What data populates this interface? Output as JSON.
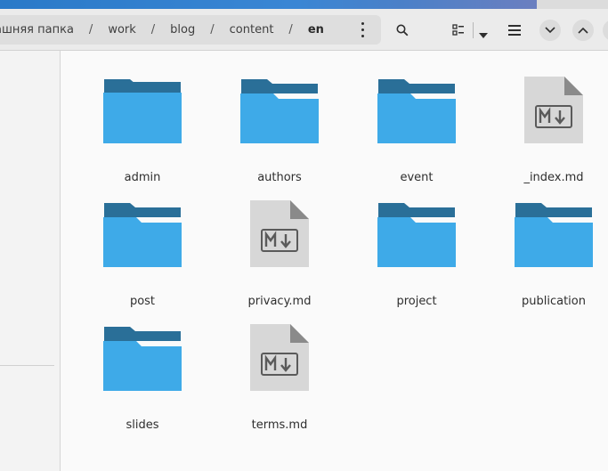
{
  "breadcrumb": {
    "items": [
      {
        "label": "ашняя папка"
      },
      {
        "label": "work"
      },
      {
        "label": "blog"
      },
      {
        "label": "content"
      },
      {
        "label": "en"
      }
    ],
    "separator": "/"
  },
  "toolbar": {
    "search_icon": "search-icon",
    "view_icon": "list-view-icon",
    "view_dropdown_icon": "caret-down-icon",
    "menu_icon": "hamburger-menu-icon",
    "minimize_icon": "chevron-down-icon",
    "maximize_icon": "chevron-up-icon"
  },
  "files": [
    {
      "name": "admin",
      "type": "folder"
    },
    {
      "name": "authors",
      "type": "folder"
    },
    {
      "name": "event",
      "type": "folder"
    },
    {
      "name": "_index.md",
      "type": "markdown"
    },
    {
      "name": "post",
      "type": "folder"
    },
    {
      "name": "privacy.md",
      "type": "markdown"
    },
    {
      "name": "project",
      "type": "folder"
    },
    {
      "name": "publication",
      "type": "folder"
    },
    {
      "name": "slides",
      "type": "folder"
    },
    {
      "name": "terms.md",
      "type": "markdown"
    }
  ],
  "colors": {
    "folder_front": "#3eaae8",
    "folder_back": "#2a6f98",
    "doc_page": "#d7d7d7",
    "doc_fold": "#8a8a8a",
    "accent": "#3a86d4"
  }
}
